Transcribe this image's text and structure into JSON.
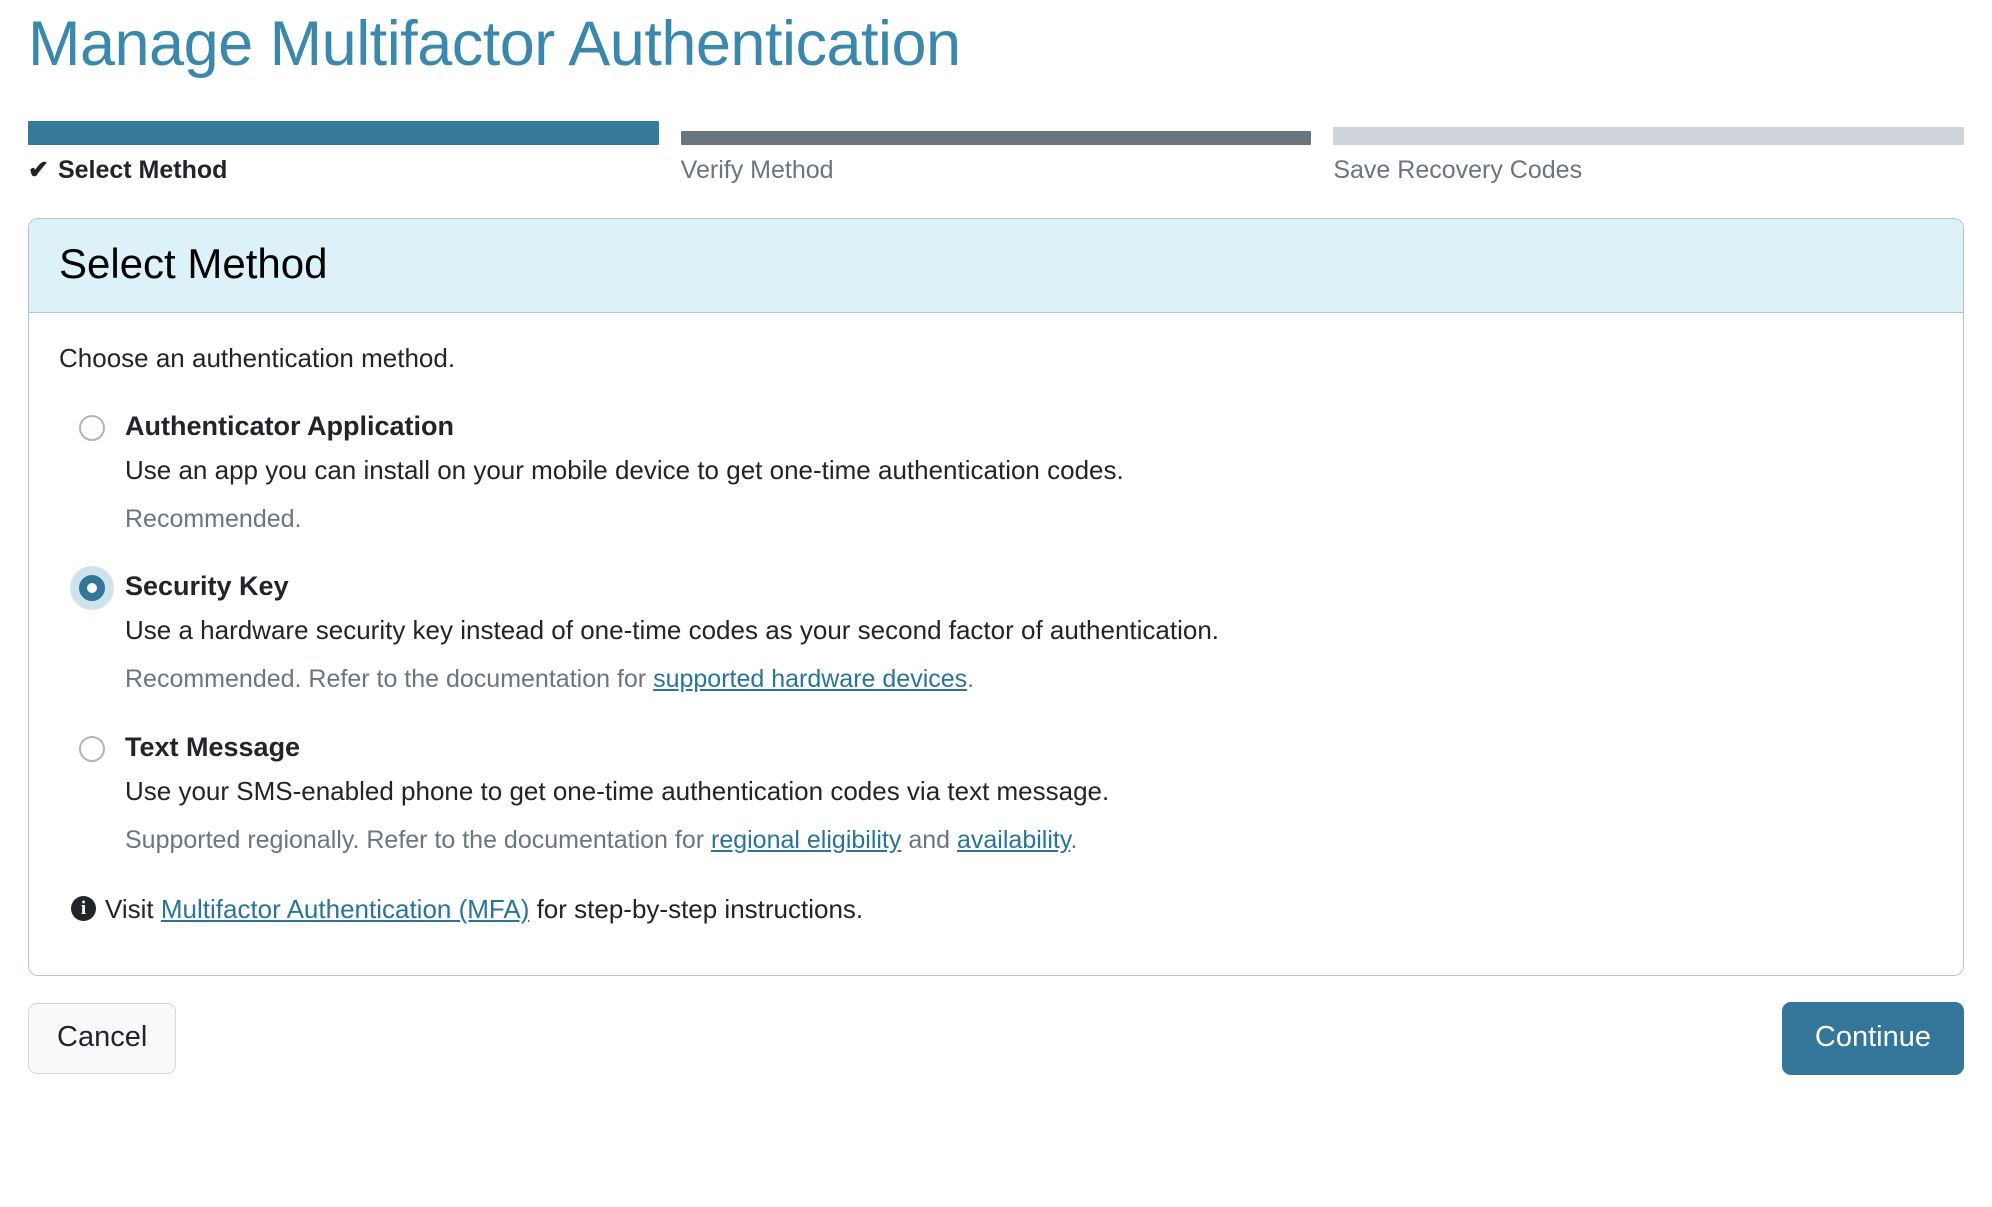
{
  "page": {
    "title": "Manage Multifactor Authentication"
  },
  "stepper": {
    "steps": [
      {
        "label": "Select Method",
        "state": "complete",
        "check": "✔"
      },
      {
        "label": "Verify Method",
        "state": "current",
        "check": ""
      },
      {
        "label": "Save Recovery Codes",
        "state": "upcoming",
        "check": ""
      }
    ]
  },
  "card": {
    "header_title": "Select Method",
    "intro": "Choose an authentication method.",
    "options": [
      {
        "title": "Authenticator Application",
        "description": "Use an app you can install on your mobile device to get one-time authentication codes.",
        "note_prefix": "Recommended.",
        "note_mid": "",
        "note_link1": "",
        "note_between": "",
        "note_link2": "",
        "note_suffix": "",
        "selected": false
      },
      {
        "title": "Security Key",
        "description": "Use a hardware security key instead of one-time codes as your second factor of authentication.",
        "note_prefix": "Recommended. Refer to the documentation for ",
        "note_link1": "supported hardware devices",
        "note_between": "",
        "note_link2": "",
        "note_suffix": ".",
        "selected": true
      },
      {
        "title": "Text Message",
        "description": "Use your SMS-enabled phone to get one-time authentication codes via text message.",
        "note_prefix": "Supported regionally. Refer to the documentation for ",
        "note_link1": "regional eligibility",
        "note_between": " and ",
        "note_link2": "availability",
        "note_suffix": ".",
        "selected": false
      }
    ],
    "info": {
      "icon": "info-icon",
      "glyph": "i",
      "prefix": "Visit ",
      "link": "Multifactor Authentication (MFA)",
      "suffix": " for step-by-step instructions."
    }
  },
  "footer": {
    "cancel_label": "Cancel",
    "continue_label": "Continue"
  },
  "colors": {
    "accent": "#337699",
    "title": "#3a88ab",
    "header_bg": "#ddf1f8",
    "step_current": "#6c757d",
    "step_upcoming": "#ced4da",
    "link": "#2a7497"
  }
}
